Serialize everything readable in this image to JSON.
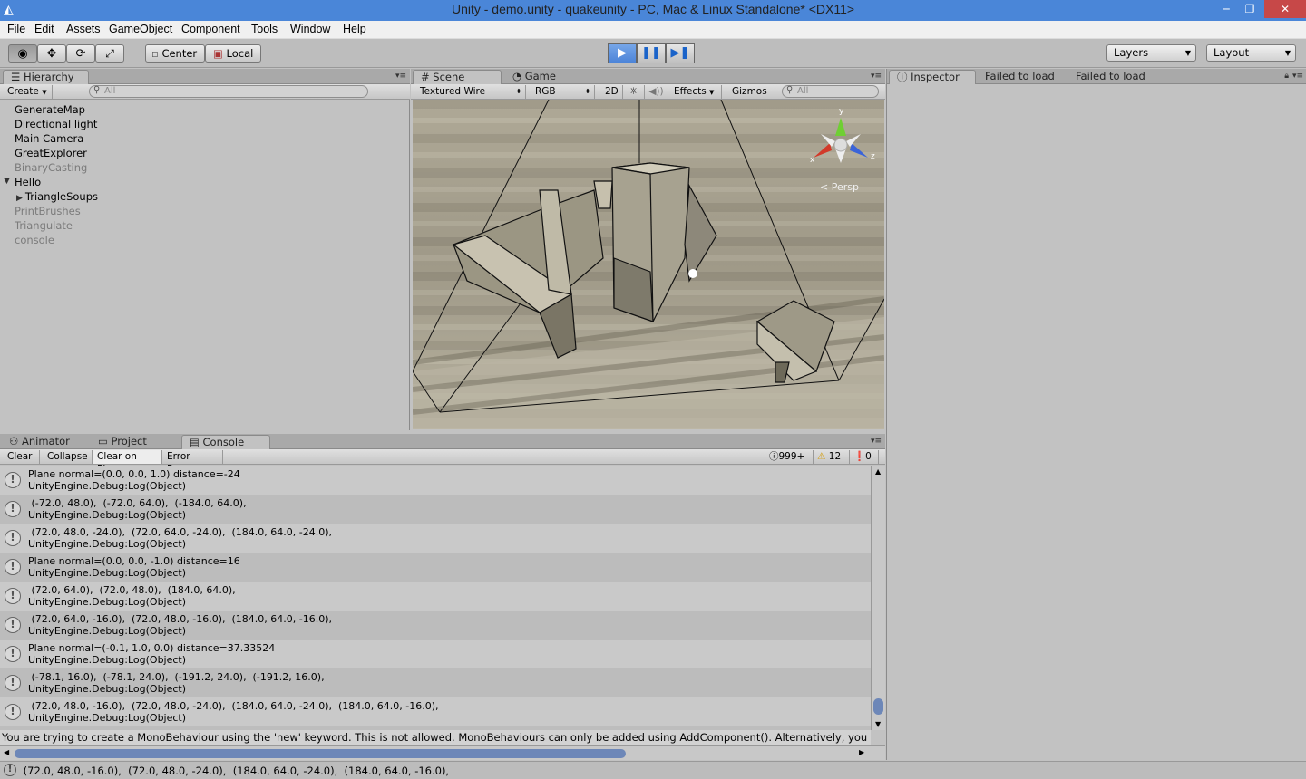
{
  "window": {
    "title": "Unity - demo.unity - quakeunity - PC, Mac & Linux Standalone* <DX11>",
    "minimize": "─",
    "restore": "❐",
    "close": "✕"
  },
  "menu": [
    "File",
    "Edit",
    "Assets",
    "GameObject",
    "Component",
    "Tools",
    "Window",
    "Help"
  ],
  "toolbar": {
    "pivot": "Center",
    "space": "Local",
    "layers": "Layers",
    "layout": "Layout",
    "tools": [
      "hand-icon",
      "move-icon",
      "rotate-icon",
      "scale-icon"
    ],
    "playback": [
      "play-icon",
      "pause-icon",
      "step-icon"
    ]
  },
  "hierarchy": {
    "tab": "Hierarchy",
    "create": "Create",
    "search_placeholder": "All",
    "items": [
      {
        "label": "GenerateMap",
        "dim": false
      },
      {
        "label": "Directional light",
        "dim": false
      },
      {
        "label": "Main Camera",
        "dim": false
      },
      {
        "label": "GreatExplorer",
        "dim": false
      },
      {
        "label": "BinaryCasting",
        "dim": true
      },
      {
        "label": "Hello",
        "dim": false,
        "expanded": true
      },
      {
        "label": "TriangleSoups",
        "dim": false,
        "child": true
      },
      {
        "label": "PrintBrushes",
        "dim": true
      },
      {
        "label": "Triangulate",
        "dim": true
      },
      {
        "label": "console",
        "dim": true
      }
    ]
  },
  "scene": {
    "tab_scene": "Scene",
    "tab_game": "Game",
    "shading": "Textured Wire",
    "render_mode": "RGB",
    "mode2d": "2D",
    "effects": "Effects",
    "gizmos": "Gizmos",
    "search_placeholder": "All",
    "persp": "< Persp",
    "axis_y": "y",
    "axis_x": "x",
    "axis_z": "z"
  },
  "inspector": {
    "tab": "Inspector",
    "tab2": "Failed to load",
    "tab3": "Failed to load"
  },
  "bottom_tabs": {
    "animator": "Animator",
    "project": "Project",
    "console": "Console"
  },
  "console": {
    "buttons": [
      "Clear",
      "Collapse",
      "Clear on Play",
      "Error Pause"
    ],
    "counts": {
      "log": "999+",
      "warn": "12",
      "error": "0"
    },
    "entries": [
      {
        "l1": "Plane normal=(0.0, 0.0, 1.0) distance=-24",
        "l2": "UnityEngine.Debug:Log(Object)"
      },
      {
        "l1": " (-72.0, 48.0),  (-72.0, 64.0),  (-184.0, 64.0),",
        "l2": "UnityEngine.Debug:Log(Object)"
      },
      {
        "l1": " (72.0, 48.0, -24.0),  (72.0, 64.0, -24.0),  (184.0, 64.0, -24.0),",
        "l2": "UnityEngine.Debug:Log(Object)"
      },
      {
        "l1": "Plane normal=(0.0, 0.0, -1.0) distance=16",
        "l2": "UnityEngine.Debug:Log(Object)"
      },
      {
        "l1": " (72.0, 64.0),  (72.0, 48.0),  (184.0, 64.0),",
        "l2": "UnityEngine.Debug:Log(Object)"
      },
      {
        "l1": " (72.0, 64.0, -16.0),  (72.0, 48.0, -16.0),  (184.0, 64.0, -16.0),",
        "l2": "UnityEngine.Debug:Log(Object)"
      },
      {
        "l1": "Plane normal=(-0.1, 1.0, 0.0) distance=37.33524",
        "l2": "UnityEngine.Debug:Log(Object)"
      },
      {
        "l1": " (-78.1, 16.0),  (-78.1, 24.0),  (-191.2, 24.0),  (-191.2, 16.0),",
        "l2": "UnityEngine.Debug:Log(Object)"
      },
      {
        "l1": " (72.0, 48.0, -16.0),  (72.0, 48.0, -24.0),  (184.0, 64.0, -24.0),  (184.0, 64.0, -16.0),",
        "l2": "UnityEngine.Debug:Log(Object)"
      }
    ],
    "detail": "You are trying to create a MonoBehaviour using the 'new' keyword.  This is not allowed.  MonoBehaviours can only be added using AddComponent().  Alternatively, you",
    "status": " (72.0, 48.0, -16.0),  (72.0, 48.0, -24.0),  (184.0, 64.0, -24.0),  (184.0, 64.0, -16.0),"
  }
}
